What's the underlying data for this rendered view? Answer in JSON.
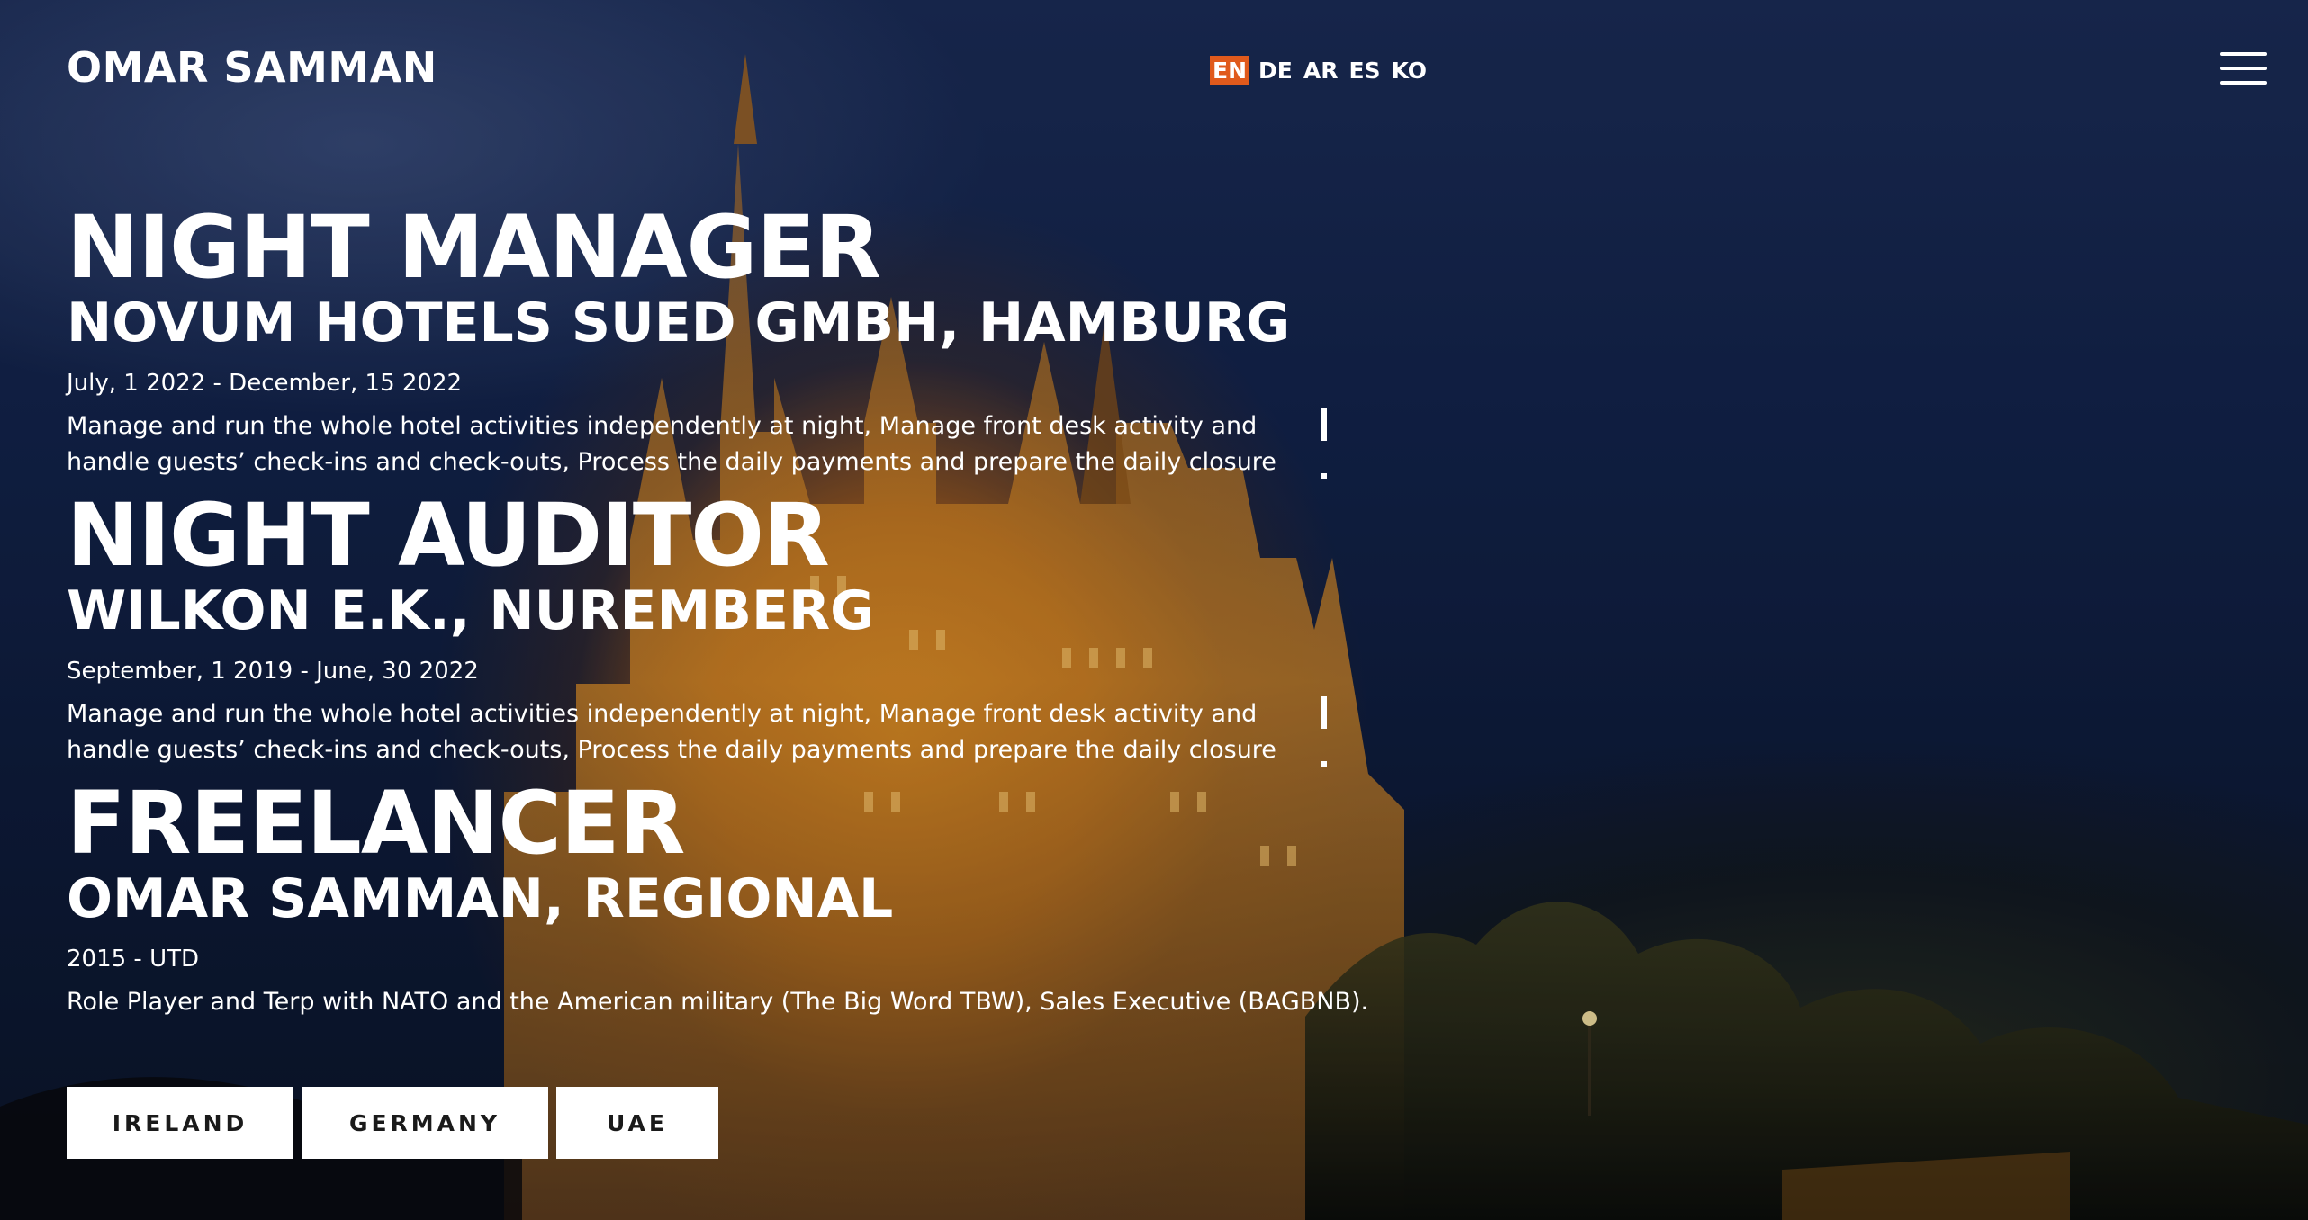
{
  "header": {
    "logo": "OMAR SAMMAN",
    "languages": [
      {
        "code": "EN",
        "active": true
      },
      {
        "code": "DE",
        "active": false
      },
      {
        "code": "AR",
        "active": false
      },
      {
        "code": "ES",
        "active": false
      },
      {
        "code": "KO",
        "active": false
      }
    ],
    "menu_icon": "hamburger-menu-icon"
  },
  "jobs": [
    {
      "title": "NIGHT MANAGER",
      "company": "NOVUM HOTELS SUED GMBH, HAMBURG",
      "date": "July, 1 2022 - December, 15 2022",
      "description": "Manage and run the whole hotel activities independently at night, Manage front desk activity and handle guests’ check-ins and check-outs, Process the daily payments and prepare the daily closure reports and"
    },
    {
      "title": "NIGHT AUDITOR",
      "company": "WILKON E.K., NUREMBERG",
      "date": "September, 1 2019 - June, 30 2022",
      "description": "Manage and run the whole hotel activities independently at night, Manage front desk activity and handle guests’ check-ins and check-outs, Process the daily payments and prepare the daily closure reports and"
    },
    {
      "title": "FREELANCER",
      "company": "OMAR SAMMAN, REGIONAL",
      "date": "2015 - UTD",
      "description": "Role Player and Terp with NATO and the American military (The Big Word TBW), Sales Executive (BAGBNB)."
    }
  ],
  "countries": [
    "IRELAND",
    "GERMANY",
    "UAE"
  ],
  "colors": {
    "accent": "#e05a1c",
    "text": "#ffffff",
    "button_bg": "#ffffff",
    "button_text": "#1a1a1a"
  }
}
